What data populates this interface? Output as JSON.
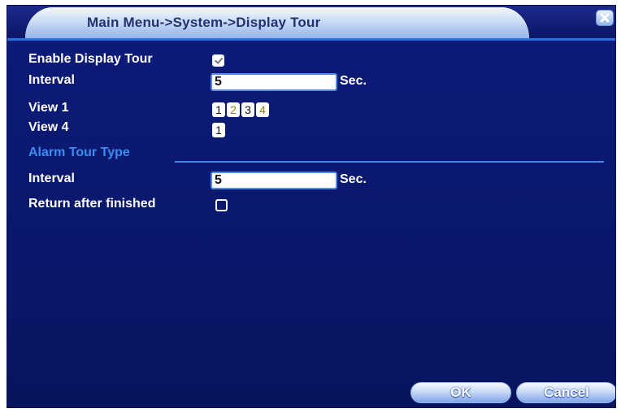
{
  "window": {
    "title": "Main Menu->System->Display Tour"
  },
  "form": {
    "enable_display_tour": {
      "label": "Enable Display Tour",
      "checked": true
    },
    "interval": {
      "label": "Interval",
      "value": "5",
      "unit": "Sec."
    },
    "view1": {
      "label": "View 1",
      "buttons": [
        "1",
        "2",
        "3",
        "4"
      ]
    },
    "view4": {
      "label": "View 4",
      "buttons": [
        "1"
      ]
    },
    "alarm_section": {
      "label": "Alarm Tour Type"
    },
    "alarm_interval": {
      "label": "Interval",
      "value": "5",
      "unit": "Sec."
    },
    "return_after_finished": {
      "label": "Return after finished",
      "checked": false
    }
  },
  "buttons": {
    "ok": "OK",
    "cancel": "Cancel"
  },
  "colors": {
    "panel_bg": "#0c1a72",
    "accent_blue": "#3a8cf0",
    "title_text": "#243070"
  }
}
